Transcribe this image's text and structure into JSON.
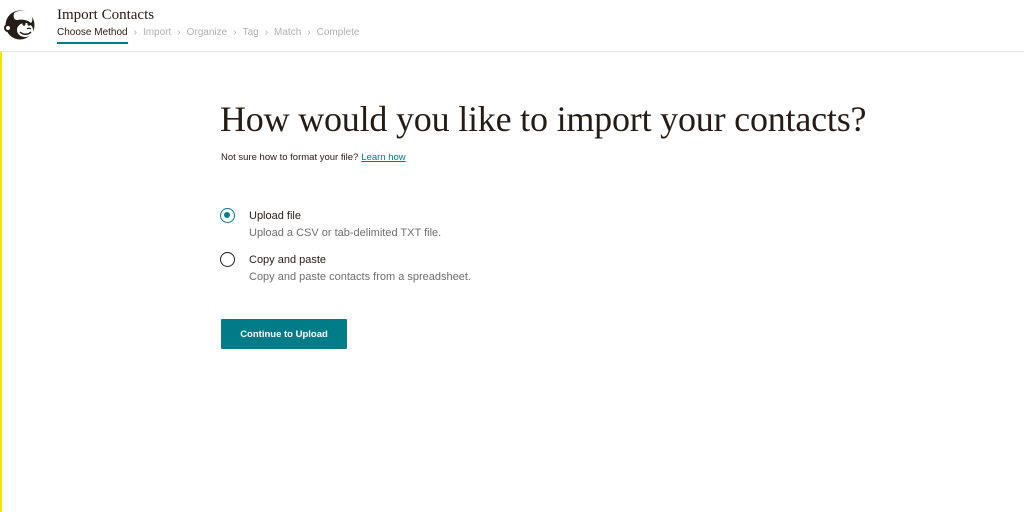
{
  "header": {
    "title": "Import Contacts",
    "steps": [
      {
        "label": "Choose Method",
        "active": true
      },
      {
        "label": "Import",
        "active": false
      },
      {
        "label": "Organize",
        "active": false
      },
      {
        "label": "Tag",
        "active": false
      },
      {
        "label": "Match",
        "active": false
      },
      {
        "label": "Complete",
        "active": false
      }
    ],
    "separator": "›"
  },
  "main": {
    "heading": "How would you like to import your contacts?",
    "helper_text": "Not sure how to format your file?",
    "helper_link": "Learn how",
    "options": [
      {
        "label": "Upload file",
        "description": "Upload a CSV or tab-delimited TXT file.",
        "selected": true
      },
      {
        "label": "Copy and paste",
        "description": "Copy and paste contacts from a spreadsheet.",
        "selected": false
      }
    ],
    "continue_button": "Continue to Upload"
  },
  "colors": {
    "accent": "#007c89",
    "text": "#241c15",
    "muted": "#b0b0b0",
    "left_edge": "#f4e500"
  },
  "icons": {
    "logo": "mailchimp-monkey-icon",
    "radio_selected": "radio-checked-icon",
    "radio_unselected": "radio-unchecked-icon"
  }
}
